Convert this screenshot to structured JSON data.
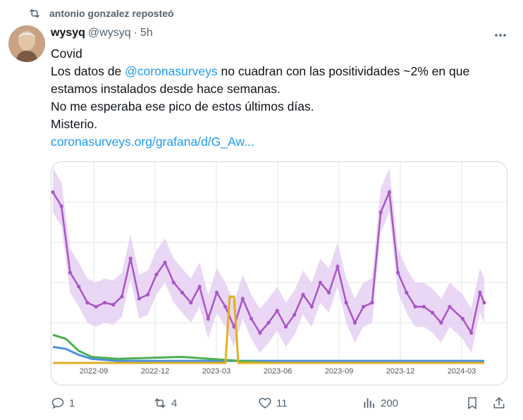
{
  "repost": {
    "text": "antonio gonzalez reposteó"
  },
  "tweet": {
    "display_name": "wysyq",
    "handle": "@wysyq",
    "separator": "·",
    "time": "5h",
    "lines": [
      "Covid",
      "Los datos de ",
      "@coronasurveys",
      " no cuadran con las positividades ~2% en que",
      "estamos instalados desde hace semanas.",
      "No me esperaba ese pico de estos últimos días.",
      "Misterio.",
      "coronasurveys.org/grafana/d/G_Aw..."
    ]
  },
  "chart_data": {
    "type": "line",
    "title": "",
    "xlabel": "",
    "ylabel": "",
    "x_ticks": [
      "2022-09",
      "2022-12",
      "2023-03",
      "2023-06",
      "2023-09",
      "2023-12",
      "2024-03"
    ],
    "x_range": [
      "2022-07",
      "2024-05"
    ],
    "grid": true,
    "series": [
      {
        "color": "#a855c8",
        "band_color": "#e3cdf2",
        "points": [
          [
            0.0,
            0.85
          ],
          [
            0.02,
            0.78
          ],
          [
            0.04,
            0.45
          ],
          [
            0.06,
            0.38
          ],
          [
            0.08,
            0.3
          ],
          [
            0.1,
            0.28
          ],
          [
            0.12,
            0.3
          ],
          [
            0.14,
            0.29
          ],
          [
            0.16,
            0.33
          ],
          [
            0.18,
            0.52
          ],
          [
            0.2,
            0.32
          ],
          [
            0.22,
            0.34
          ],
          [
            0.24,
            0.44
          ],
          [
            0.26,
            0.5
          ],
          [
            0.28,
            0.4
          ],
          [
            0.3,
            0.35
          ],
          [
            0.32,
            0.3
          ],
          [
            0.34,
            0.38
          ],
          [
            0.36,
            0.22
          ],
          [
            0.38,
            0.35
          ],
          [
            0.4,
            0.28
          ],
          [
            0.42,
            0.18
          ],
          [
            0.44,
            0.32
          ],
          [
            0.46,
            0.22
          ],
          [
            0.48,
            0.15
          ],
          [
            0.5,
            0.2
          ],
          [
            0.52,
            0.26
          ],
          [
            0.54,
            0.18
          ],
          [
            0.56,
            0.24
          ],
          [
            0.58,
            0.34
          ],
          [
            0.6,
            0.28
          ],
          [
            0.62,
            0.4
          ],
          [
            0.64,
            0.35
          ],
          [
            0.66,
            0.48
          ],
          [
            0.68,
            0.3
          ],
          [
            0.7,
            0.2
          ],
          [
            0.72,
            0.28
          ],
          [
            0.74,
            0.3
          ],
          [
            0.76,
            0.75
          ],
          [
            0.78,
            0.85
          ],
          [
            0.8,
            0.45
          ],
          [
            0.82,
            0.35
          ],
          [
            0.84,
            0.28
          ],
          [
            0.86,
            0.28
          ],
          [
            0.88,
            0.25
          ],
          [
            0.9,
            0.2
          ],
          [
            0.92,
            0.28
          ],
          [
            0.95,
            0.22
          ],
          [
            0.97,
            0.15
          ],
          [
            0.99,
            0.35
          ],
          [
            1.0,
            0.3
          ]
        ]
      },
      {
        "color": "#4a90e2",
        "points": [
          [
            0.0,
            0.08
          ],
          [
            0.03,
            0.07
          ],
          [
            0.06,
            0.04
          ],
          [
            0.09,
            0.02
          ],
          [
            0.15,
            0.01
          ],
          [
            1.0,
            0.01
          ]
        ]
      },
      {
        "color": "#4caf50",
        "points": [
          [
            0.0,
            0.14
          ],
          [
            0.03,
            0.12
          ],
          [
            0.06,
            0.06
          ],
          [
            0.09,
            0.03
          ],
          [
            0.15,
            0.02
          ],
          [
            0.3,
            0.03
          ],
          [
            0.5,
            0.0
          ],
          [
            1.0,
            0.0
          ]
        ]
      },
      {
        "color": "#e0b020",
        "points": [
          [
            0.0,
            0.0
          ],
          [
            0.4,
            0.0
          ],
          [
            0.41,
            0.33
          ],
          [
            0.42,
            0.33
          ],
          [
            0.43,
            0.0
          ],
          [
            1.0,
            0.0
          ]
        ]
      }
    ]
  },
  "actions": {
    "reply_count": "1",
    "repost_count": "4",
    "like_count": "11",
    "views_count": "200"
  },
  "colors": {
    "accent": "#1d9bf0",
    "muted": "#536471"
  }
}
